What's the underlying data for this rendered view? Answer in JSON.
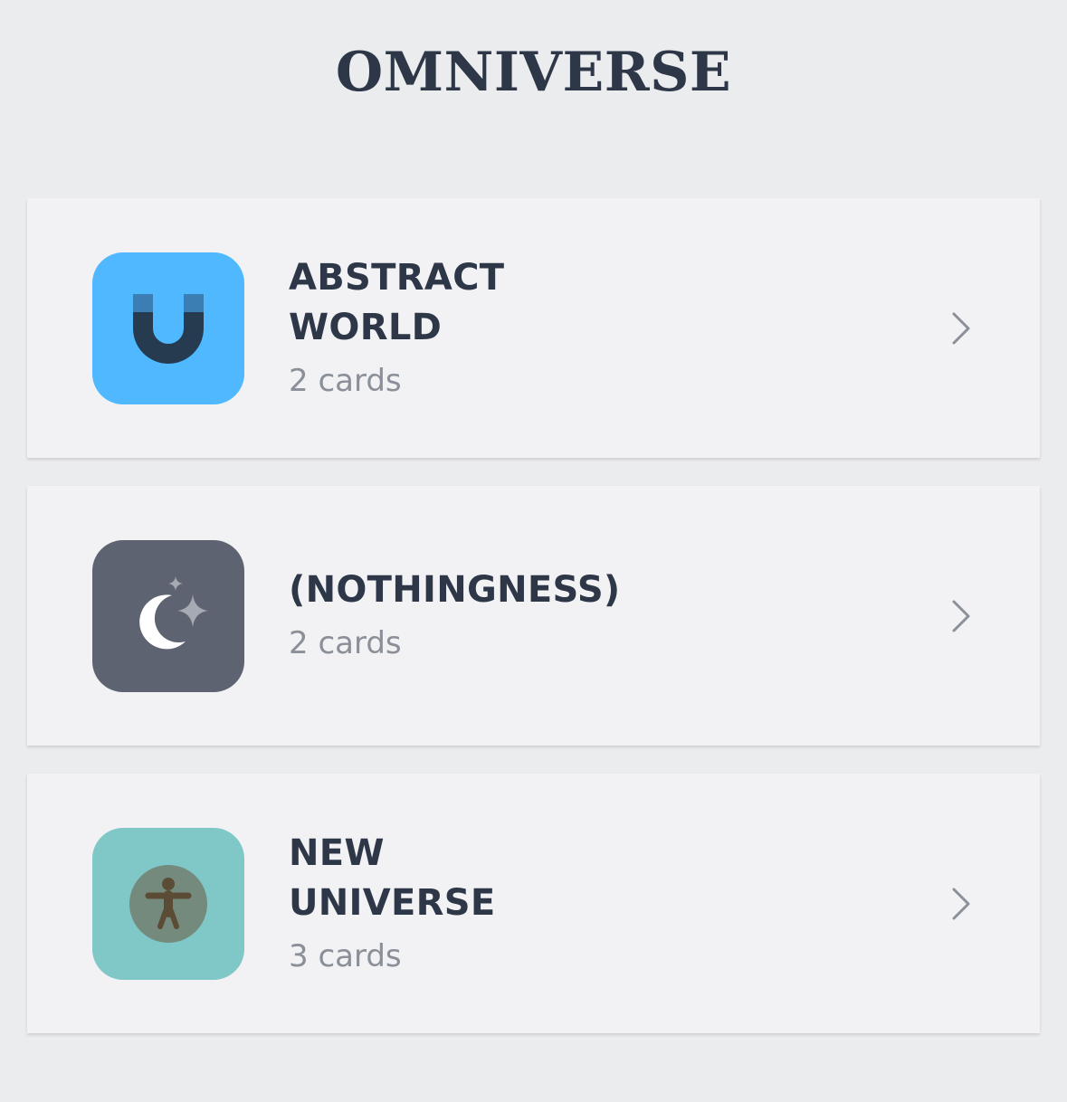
{
  "header": {
    "title": "OMNIVERSE"
  },
  "collections": [
    {
      "name": "ABSTRACT WORLD",
      "count": "2 cards",
      "icon": "magnet-icon",
      "icon_bg": "#4fb8ff"
    },
    {
      "name": "(NOTHINGNESS)",
      "count": "2 cards",
      "icon": "moon-stars-icon",
      "icon_bg": "#5e6371"
    },
    {
      "name": "NEW UNIVERSE",
      "count": "3 cards",
      "icon": "accessibility-icon",
      "icon_bg": "#80c7c8"
    }
  ],
  "colors": {
    "background": "#ebecee",
    "card": "#f2f2f4",
    "title_text": "#2d3748",
    "subtitle_text": "#8a8f98",
    "chevron": "#8a8f98"
  }
}
